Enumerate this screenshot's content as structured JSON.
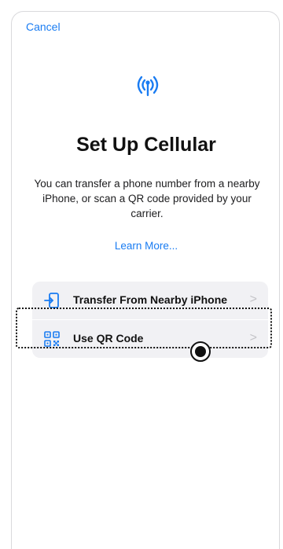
{
  "nav": {
    "cancel_label": "Cancel"
  },
  "header": {
    "icon": "cellular-antenna-icon",
    "title": "Set Up Cellular",
    "description": "You can transfer a phone number from a nearby iPhone, or scan a QR code provided by your carrier.",
    "learn_more": "Learn More..."
  },
  "options": [
    {
      "label": "Transfer From Nearby iPhone",
      "icon": "transfer-phone-icon",
      "chevron": ">"
    },
    {
      "label": "Use QR Code",
      "icon": "qr-code-icon",
      "chevron": ">"
    }
  ],
  "colors": {
    "accent": "#1a7cf2",
    "row_background": "#f1f1f4",
    "text": "#111111"
  }
}
